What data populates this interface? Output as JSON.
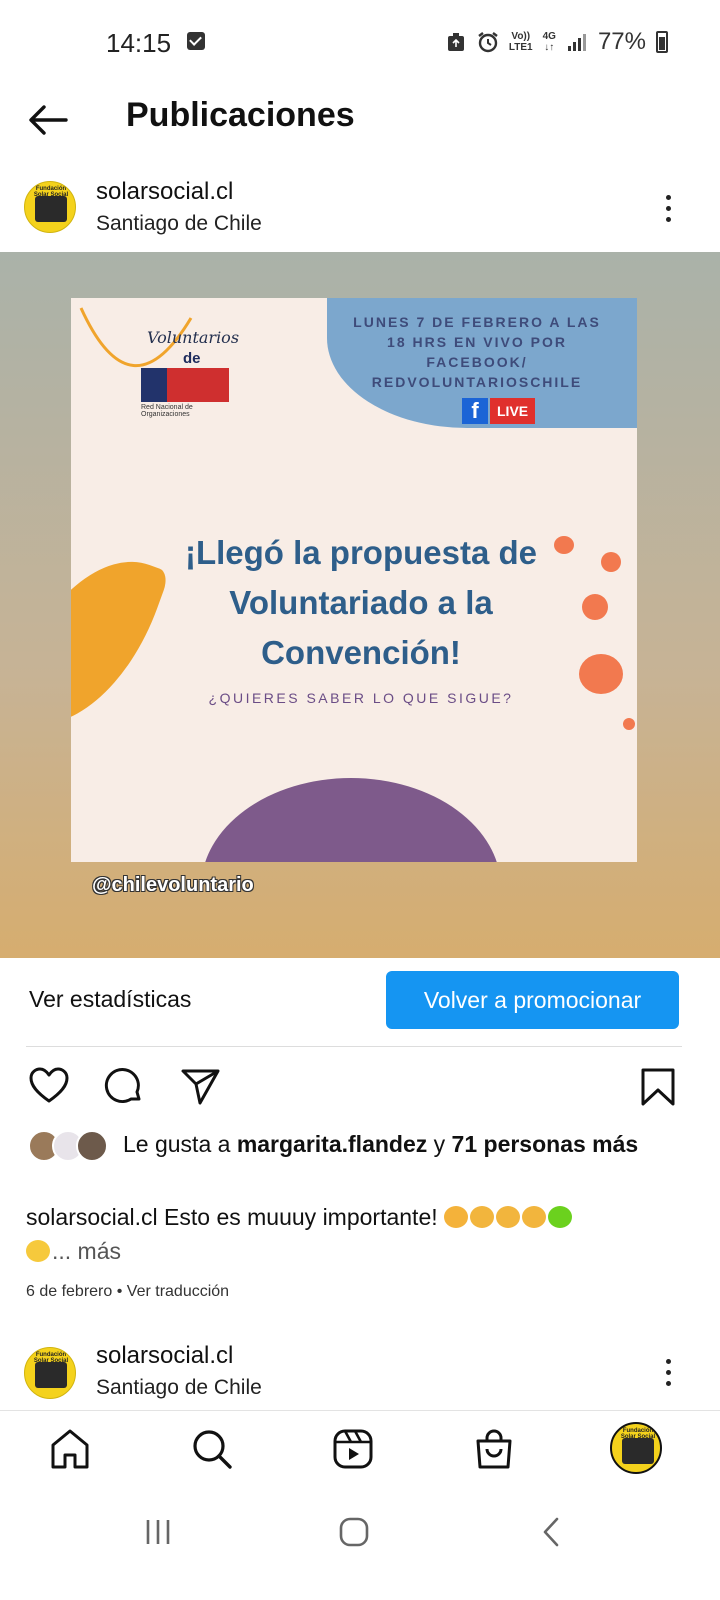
{
  "status_bar": {
    "time": "14:15",
    "volte_line1": "Vo))",
    "volte_line2": "LTE1",
    "network_type": "4G",
    "battery_percent": "77%"
  },
  "header": {
    "title": "Publicaciones"
  },
  "post": {
    "username": "solarsocial.cl",
    "location": "Santiago de Chile",
    "image": {
      "logo_title_line1": "Voluntarios",
      "logo_title_line2": "de CHILE",
      "logo_subtitle": "Red Nacional de Organizaciones",
      "event_text": "LUNES 7 DE FEBRERO A LAS 18 HRS EN VIVO POR FACEBOOK/ REDVOLUNTARIOSCHILE",
      "fb_letter": "f",
      "live_label": "LIVE",
      "headline": "¡Llegó la propuesta de Voluntariado a la Convención!",
      "subheadline": "¿QUIERES SABER LO QUE SIGUE?",
      "watermark": "@chilevoluntario"
    },
    "stats_link": "Ver estadísticas",
    "promote_button": "Volver a promocionar",
    "likes": {
      "prefix": "Le gusta a ",
      "user": "margarita.flandez",
      "middle": " y ",
      "count": "71 personas más"
    },
    "caption": {
      "username": "solarsocial.cl",
      "text": " Esto es muuuy importante! ",
      "more": "... más"
    },
    "date": "6 de febrero",
    "separator": " • ",
    "translate_link": "Ver traducción"
  },
  "next_post": {
    "username": "solarsocial.cl",
    "location": "Santiago de Chile"
  },
  "avatar_label": "Fundación Solar Social",
  "icons": [
    "back-arrow-icon",
    "more-icon",
    "heart-icon",
    "comment-icon",
    "share-icon",
    "bookmark-icon",
    "home-icon",
    "search-icon",
    "reels-icon",
    "shop-icon",
    "profile-icon"
  ],
  "colors": {
    "promote_button": "#1595f2",
    "avatar_bg": "#f4d21c",
    "poster_headline": "#2e5e8a"
  }
}
